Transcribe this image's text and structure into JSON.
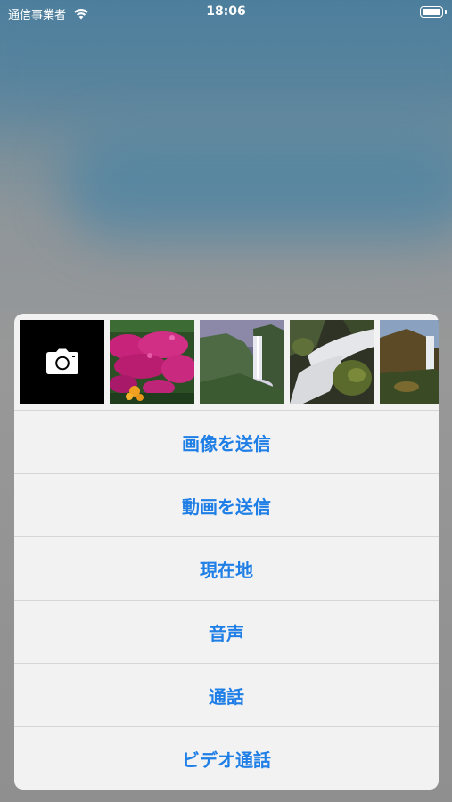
{
  "status_bar": {
    "carrier": "通信事業者",
    "time": "18:06"
  },
  "photo_picker": {
    "camera_icon": "camera-icon",
    "thumbnails": [
      {
        "subject": "pink-flowers-photo"
      },
      {
        "subject": "waterfall-valley-photo"
      },
      {
        "subject": "waterfall-rocks-photo"
      },
      {
        "subject": "waterfall-cliff-photo"
      }
    ]
  },
  "actions": [
    {
      "label": "画像を送信"
    },
    {
      "label": "動画を送信"
    },
    {
      "label": "現在地"
    },
    {
      "label": "音声"
    },
    {
      "label": "通話"
    },
    {
      "label": "ビデオ通話"
    }
  ],
  "colors": {
    "accent": "#1f7fe6",
    "sheet_background": "#f2f2f2"
  }
}
